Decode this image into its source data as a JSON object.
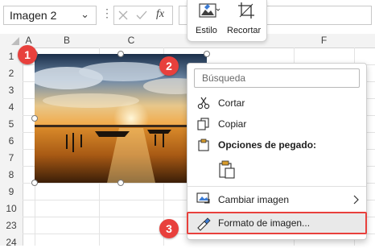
{
  "formula_bar": {
    "name_box_value": "Imagen 2",
    "fx_label": "fx"
  },
  "mini_toolbar": {
    "style_label": "Estilo",
    "crop_label": "Recortar"
  },
  "sheet": {
    "col_headers": [
      "A",
      "B",
      "C",
      "F"
    ],
    "row_headers": [
      "1",
      "2",
      "3",
      "4",
      "5",
      "6",
      "7",
      "8",
      "9",
      "10",
      "23",
      "24"
    ]
  },
  "context_menu": {
    "search_placeholder": "Búsqueda",
    "cut_label": "Cortar",
    "copy_label": "Copiar",
    "paste_options_label": "Opciones de pegado:",
    "change_image_label": "Cambiar imagen",
    "format_image_label": "Formato de imagen..."
  },
  "callouts": [
    "1",
    "2",
    "3"
  ],
  "colors": {
    "callout_red": "#e8403c",
    "header_bg": "#f3f3f3",
    "gridline": "#e3e3e3",
    "highlight_bg": "#e9e9e9"
  },
  "icons": {
    "cut": "scissors-icon",
    "copy": "copy-icon",
    "paste": "clipboard-icon",
    "change_image": "change-image-icon",
    "format_image": "format-brush-icon",
    "submenu": "chevron-right-icon"
  }
}
